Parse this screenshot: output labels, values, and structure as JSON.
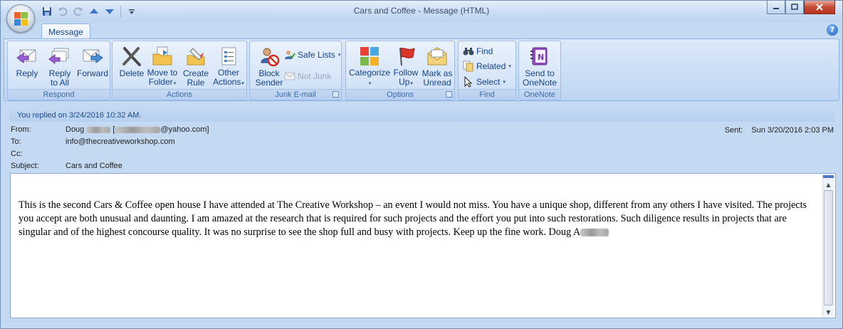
{
  "window": {
    "title": "Cars and Coffee - Message (HTML)"
  },
  "tabs": [
    {
      "label": "Message"
    }
  ],
  "ribbon": {
    "groups": {
      "respond": {
        "label": "Respond",
        "reply": "Reply",
        "reply_all_1": "Reply",
        "reply_all_2": "to All",
        "forward": "Forward"
      },
      "actions": {
        "label": "Actions",
        "delete": "Delete",
        "move_1": "Move to",
        "move_2": "Folder",
        "create_1": "Create",
        "create_2": "Rule",
        "other_1": "Other",
        "other_2": "Actions"
      },
      "junk": {
        "label": "Junk E-mail",
        "block_1": "Block",
        "block_2": "Sender",
        "safe_lists": "Safe Lists",
        "not_junk": "Not Junk"
      },
      "options": {
        "label": "Options",
        "categorize": "Categorize",
        "follow_1": "Follow",
        "follow_2": "Up",
        "mark_1": "Mark as",
        "mark_2": "Unread"
      },
      "find": {
        "label": "Find",
        "find": "Find",
        "related": "Related",
        "select": "Select"
      },
      "onenote": {
        "label": "OneNote",
        "send_1": "Send to",
        "send_2": "OneNote"
      }
    }
  },
  "infobar": {
    "text": "You replied on 3/24/2016 10:32 AM."
  },
  "header": {
    "from_label": "From:",
    "from_name": "Doug",
    "from_email_domain": "@yahoo.com]",
    "from_bracket_open": "[",
    "to_label": "To:",
    "to_value": "info@thecreativeworkshop.com",
    "cc_label": "Cc:",
    "subject_label": "Subject:",
    "subject_value": "Cars and Coffee",
    "sent_label": "Sent:",
    "sent_value": "Sun 3/20/2016 2:03 PM"
  },
  "message": {
    "body": "This is the second Cars & Coffee open house I have attended at The Creative Workshop – an event I would not miss.  You have a unique shop, different from any others I have visited.  The projects you accept are both unusual and daunting.  I am amazed at the research that is required for such projects and the effort you put into such restorations.  Such diligence results in projects that are singular and of the highest concourse quality.  It was no surprise to see the shop full and busy with projects.  Keep up the fine work.  Doug A"
  },
  "colors": {
    "ribbon_bg": "#c7dbf4",
    "accent_text": "#15428b",
    "close_button": "#c64b35"
  }
}
